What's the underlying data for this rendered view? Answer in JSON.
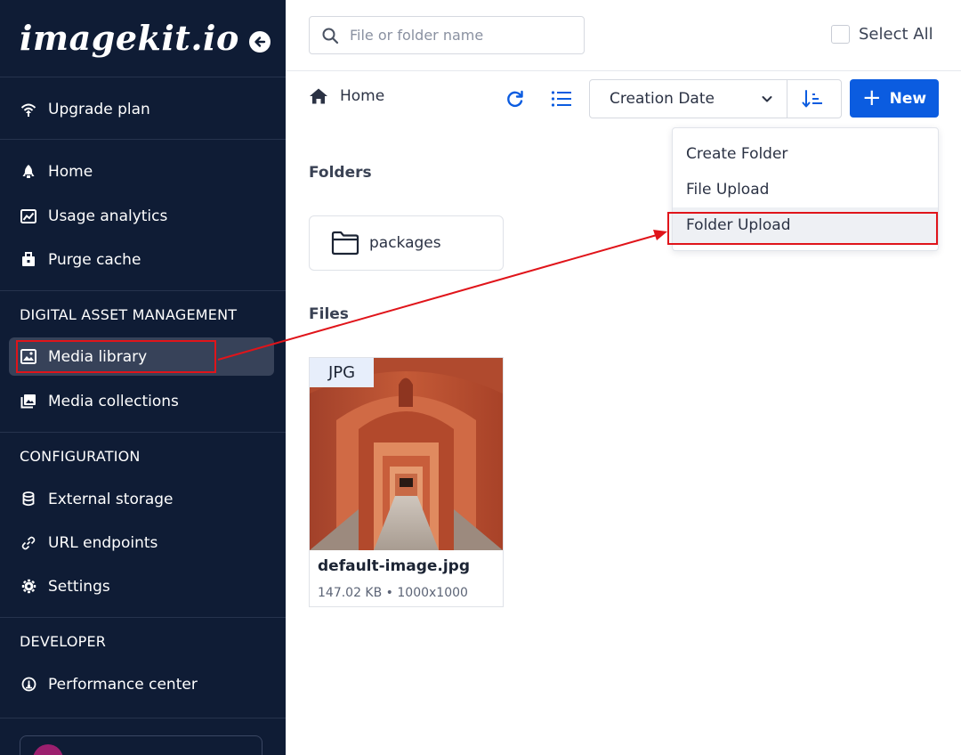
{
  "app": {
    "logo": "imagekit.io"
  },
  "sidebar": {
    "upgrade": {
      "label": "Upgrade plan"
    },
    "items": [
      {
        "label": "Home"
      },
      {
        "label": "Usage analytics"
      },
      {
        "label": "Purge cache"
      }
    ],
    "sections": {
      "dam": {
        "title": "DIGITAL ASSET MANAGEMENT",
        "items": [
          {
            "label": "Media library"
          },
          {
            "label": "Media collections"
          }
        ]
      },
      "config": {
        "title": "CONFIGURATION",
        "items": [
          {
            "label": "External storage"
          },
          {
            "label": "URL endpoints"
          },
          {
            "label": "Settings"
          }
        ]
      },
      "developer": {
        "title": "DEVELOPER",
        "items": [
          {
            "label": "Performance center"
          }
        ]
      }
    }
  },
  "header": {
    "search_placeholder": "File or folder name",
    "select_all": "Select All"
  },
  "toolbar": {
    "breadcrumb_home": "Home",
    "sort_by": "Creation Date",
    "new_label": "New"
  },
  "dropdown": {
    "items": [
      {
        "label": "Create Folder"
      },
      {
        "label": "File Upload"
      },
      {
        "label": "Folder Upload"
      }
    ]
  },
  "content": {
    "folders_title": "Folders",
    "folders": [
      {
        "name": "packages"
      }
    ],
    "files_title": "Files",
    "files": [
      {
        "type": "JPG",
        "name": "default-image.jpg",
        "meta": "147.02 KB • 1000x1000"
      }
    ]
  },
  "colors": {
    "sidebar_bg": "#0f1c35",
    "accent": "#0b5ce0",
    "annotation": "#e0141a"
  }
}
